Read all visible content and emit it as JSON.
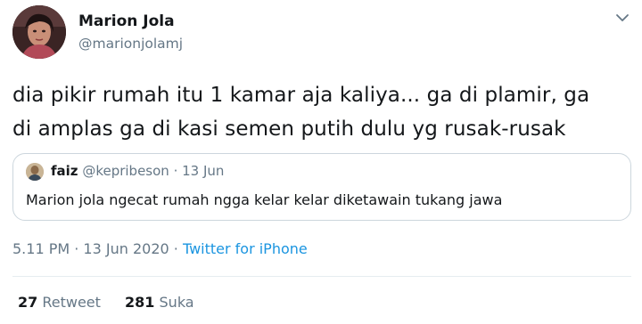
{
  "tweet": {
    "author": {
      "display_name": "Marion Jola",
      "handle": "@marionjolamj"
    },
    "text_line1": "dia pikir rumah itu 1 kamar aja kaliya... ga di plamir, ga",
    "text_line2": "di amplas ga di kasi semen putih dulu yg rusak-rusak",
    "quoted": {
      "name": "faiz",
      "meta": "@kepribeson · 13 Jun",
      "text": "Marion jola ngecat rumah ngga kelar kelar diketawain tukang jawa"
    },
    "timestamp": "5.11 PM · 13 Jun 2020 · ",
    "source": "Twitter for iPhone",
    "stats": {
      "retweets_count": "27",
      "retweets_label": "Retweet",
      "likes_count": "281",
      "likes_label": "Suka"
    }
  },
  "icons": {
    "caret": "chevron-down-icon"
  },
  "colors": {
    "link": "#1b95e0",
    "secondary_text": "#657786",
    "border": "#ccd6dd"
  }
}
